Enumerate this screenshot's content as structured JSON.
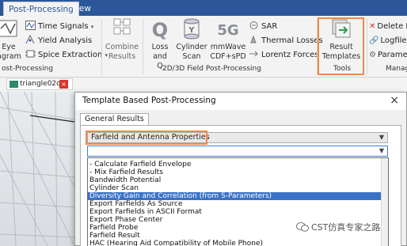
{
  "tabs": [
    {
      "label": "Post-Processing",
      "active": true
    },
    {
      "label": "View",
      "active": false
    }
  ],
  "ribbon": {
    "left_big_button": {
      "line1": "Eye",
      "line2": "agram"
    },
    "small_col1": [
      "Time Signals",
      "Yield Analysis",
      "Spice Extraction"
    ],
    "combine_results": {
      "line1": "Combine",
      "line2": "Results"
    },
    "loss_and_q": {
      "line1": "Loss and",
      "line2": "Q"
    },
    "cylinder_scan": {
      "line1": "Cylinder",
      "line2": "Scan"
    },
    "mmwave": {
      "line1": "mmWave",
      "line2": "CDF+sPD"
    },
    "small_col2": [
      "SAR",
      "Thermal Losses",
      "Lorentz Forces"
    ],
    "result_templates": {
      "line1": "Result",
      "line2": "Templates"
    },
    "small_col3": [
      "Delete R",
      "Logfile",
      "Paramet"
    ],
    "group_labels": {
      "field": "2D/3D Field Post-Processing",
      "tools": "Tools",
      "manage": "Manag",
      "left": "ost-Processing"
    }
  },
  "document_tab": {
    "label": "triangle02o",
    "close": "×"
  },
  "dialog": {
    "title": "Template Based Post-Processing",
    "close": "×",
    "tab_label": "General Results",
    "combo_category": "Farfield and Antenna Properties",
    "combo_template": "",
    "list_items": [
      "- Calculate Farfield Envelope",
      "- Mix Farfield Results",
      "Bandwidth Potential",
      "Cylinder Scan",
      "Diversity Gain and Correlation (from S-Parameters)",
      "Export Farfields As Source",
      "Export Farfields in ASCII Format",
      "Export Phase Center",
      "Farfield Probe",
      "Farfield Result",
      "HAC (Hearing Aid Compatibility of Mobile Phone)"
    ],
    "selected_index": 4
  },
  "watermark": "CST仿真专家之路",
  "colors": {
    "accent": "#2b579a",
    "highlight": "#ef8a4a",
    "selection": "#3a72c7"
  }
}
